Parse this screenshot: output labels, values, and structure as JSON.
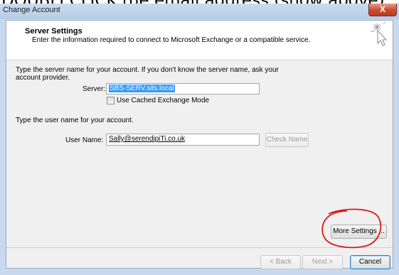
{
  "caption": {
    "text": "DOUBLECLICK the email address (show above)"
  },
  "window": {
    "title": "Change Account",
    "close_label": "X"
  },
  "header": {
    "title": "Server Settings",
    "subtitle": "Enter the information required to connect to Microsoft Exchange or a compatible service."
  },
  "server_section": {
    "instruction_line1": "Type the server name for your account. If you don't know the server name, ask your",
    "instruction_line2": "account provider.",
    "server_label": "Server:",
    "server_value": "SBS-SERV.sits.local",
    "cached_mode_label": "Use Cached Exchange Mode",
    "cached_mode_checked": false
  },
  "user_section": {
    "instruction": "Type the user name for your account.",
    "user_label": "User Name:",
    "user_value": "Sally@serendipiTi.co.uk",
    "check_name_label": "Check Name"
  },
  "buttons": {
    "more_settings": "More Settings ...",
    "back": "< Back",
    "next": "Next >",
    "cancel": "Cancel"
  },
  "colors": {
    "annotation_circle": "#e01818",
    "selection": "#3399ff"
  }
}
